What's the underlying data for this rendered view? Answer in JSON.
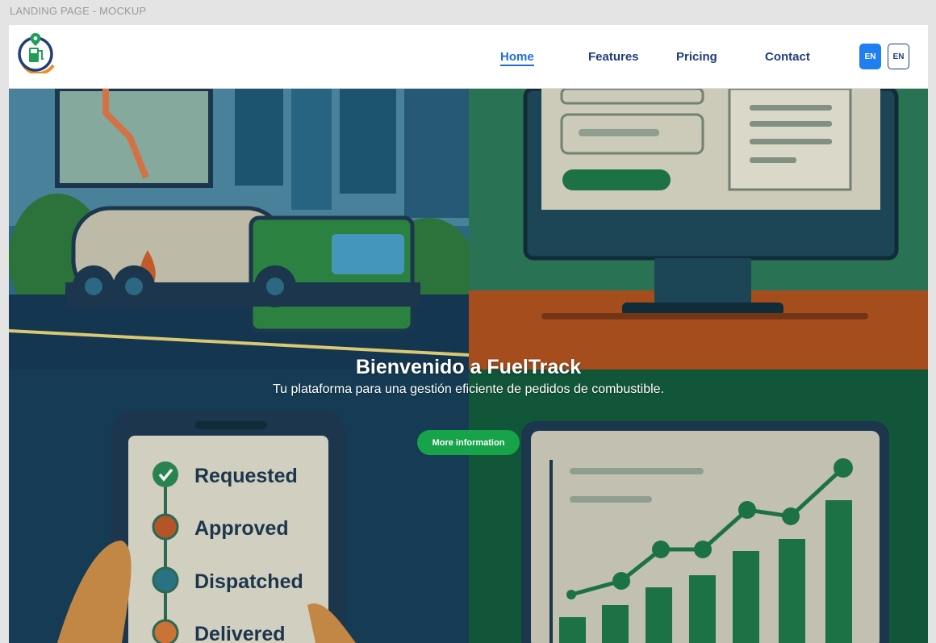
{
  "canvas_label": "LANDING PAGE - MOCKUP",
  "nav": {
    "items": [
      "Home",
      "Features",
      "Pricing",
      "Contact"
    ],
    "active": "Home",
    "lang_primary": "EN",
    "lang_secondary": "EN"
  },
  "hero": {
    "title": "Bienvenido a FuelTrack",
    "subtitle": "Tu plataforma para una gestión eficiente de pedidos de combustible.",
    "cta_label": "More information",
    "status_steps": [
      "Requested",
      "Approved",
      "Dispatched",
      "Delivered"
    ]
  },
  "colors": {
    "brand_green": "#16a34a",
    "nav_text": "#1f3f7a",
    "nav_active": "#1f6fd6",
    "lang_active": "#1f7ff0"
  },
  "icons": [
    "fuel-pump-logo-icon",
    "location-pin-icon",
    "check-icon"
  ]
}
